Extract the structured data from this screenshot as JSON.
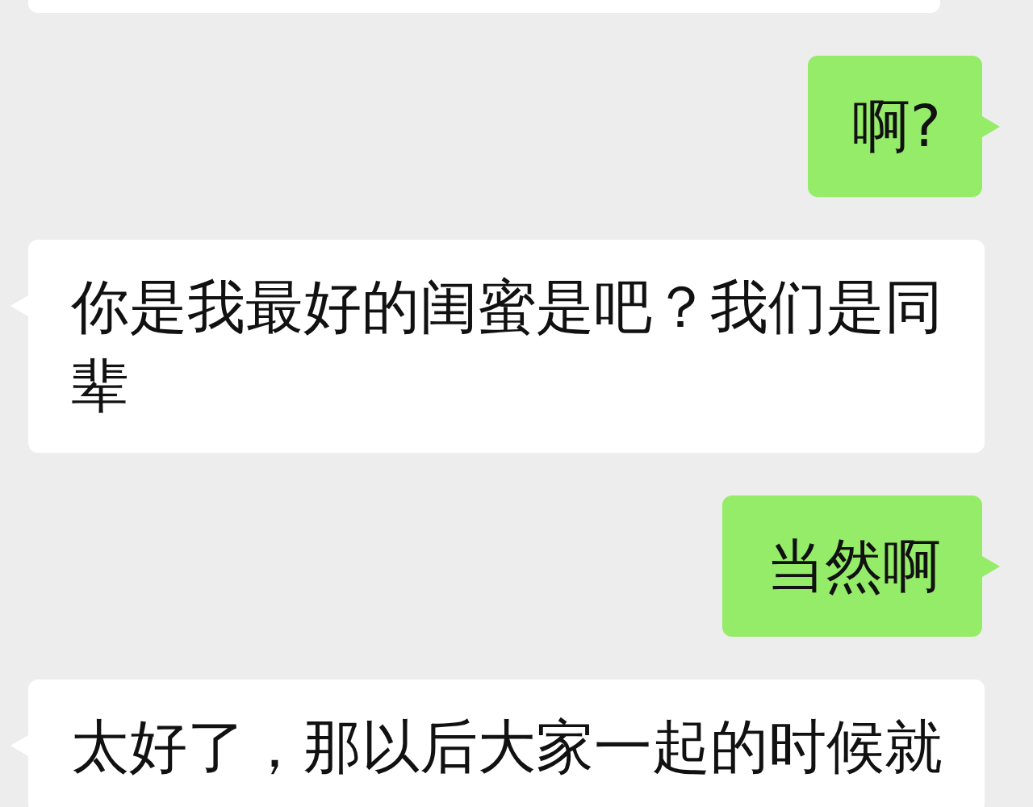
{
  "messages": [
    {
      "kind": "received"
    },
    {
      "kind": "sent",
      "text": "啊?"
    },
    {
      "kind": "received",
      "text": "你是我最好的闺蜜是吧？我们是同辈"
    },
    {
      "kind": "sent",
      "text": "当然啊"
    },
    {
      "kind": "received",
      "text": "太好了，那以后大家一起的时候就"
    }
  ]
}
